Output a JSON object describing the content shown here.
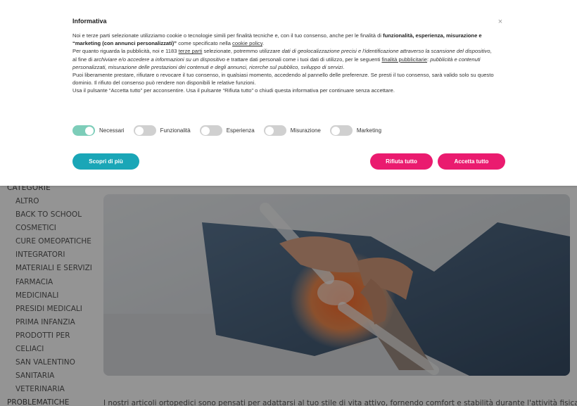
{
  "sidebar": {
    "heading": "CATEGORIE",
    "items": [
      {
        "label": "ALTRO"
      },
      {
        "label": "BACK TO SCHOOL"
      },
      {
        "label": "COSMETICI"
      },
      {
        "label": "CURE OMEOPATICHE"
      },
      {
        "label": "INTEGRATORI"
      },
      {
        "label": "MATERIALI E SERVIZI"
      },
      {
        "label": "FARMACIA"
      },
      {
        "label": "MEDICINALI"
      },
      {
        "label": "PRESIDI MEDICALI"
      },
      {
        "label": "PRIMA INFANZIA"
      },
      {
        "label": "PRODOTTI PER"
      },
      {
        "label": "CELIACI"
      },
      {
        "label": "SAN VALENTINO"
      },
      {
        "label": "SANITARIA"
      },
      {
        "label": "VETERINARIA"
      }
    ],
    "bottom_label": "PROBLEMATICHE"
  },
  "main": {
    "intro_text": "I nostri articoli ortopedici sono pensati per adattarsi al tuo stile di vita attivo, fornendo comfort e stabilità durante l'attività fisica o nella"
  },
  "cookie": {
    "title": "Informativa",
    "close_symbol": "×",
    "p1": {
      "a": "Noi e terze parti selezionate utilizziamo cookie o tecnologie simili per finalità tecniche e, con il tuo consenso, anche per le finalità di ",
      "b": "funzionalità, esperienza, misurazione e “marketing (con annunci personalizzati)”",
      "c": " come specificato nella ",
      "link": "cookie policy",
      "d": "."
    },
    "p2": {
      "a": "Per quanto riguarda la pubblicità, noi e 1183 ",
      "link1": "terze parti",
      "b": " selezionate, potremmo utilizzare ",
      "i1": "dati di geolocalizzazione precisi e l'identificazione attraverso la scansione del dispositivo",
      "c": ", al fine di ",
      "i2": "archiviare e/o accedere a informazioni su un dispositivo",
      "d": " e trattare dati personali come i tuoi dati di utilizzo, per le seguenti ",
      "link2": "finalità pubblicitarie",
      "e": ": ",
      "i3": "pubblicità e contenuti personalizzati, misurazione delle prestazioni dei contenuti e degli annunci, ricerche sul pubblico, sviluppo di servizi",
      "f": "."
    },
    "p3": "Puoi liberamente prestare, rifiutare o revocare il tuo consenso, in qualsiasi momento, accedendo al pannello delle preferenze. Se presti il tuo consenso, sarà valido solo su questo dominio. Il rifiuto del consenso può rendere non disponibili le relative funzioni.",
    "p4": "Usa il pulsante “Accetta tutto” per acconsentire. Usa il pulsante “Rifiuta tutto” o chiudi questa informativa per continuare senza accettare.",
    "toggles": [
      {
        "label": "Necessari",
        "on": true
      },
      {
        "label": "Funzionalità",
        "on": false
      },
      {
        "label": "Esperienza",
        "on": false
      },
      {
        "label": "Misurazione",
        "on": false
      },
      {
        "label": "Marketing",
        "on": false
      }
    ],
    "buttons": {
      "more": "Scopri di più",
      "reject": "Rifiuta tutto",
      "accept": "Accetta tutto"
    }
  },
  "colors": {
    "teal": "#1aa6b7",
    "pink": "#ea1b6f",
    "toggle_on": "#7dcdb9",
    "toggle_off": "#d0d0d0"
  }
}
